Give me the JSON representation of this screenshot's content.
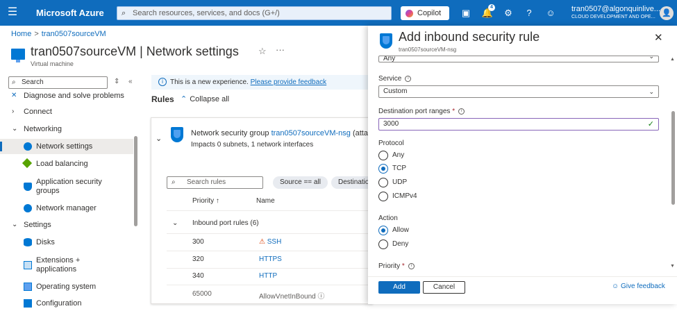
{
  "topbar": {
    "brand": "Microsoft Azure",
    "search_placeholder": "Search resources, services, and docs (G+/)",
    "copilot_label": "Copilot",
    "notification_count": "4",
    "user_email": "tran0507@algonquinlive...",
    "user_org": "CLOUD DEVELOPMENT AND OPE..."
  },
  "breadcrumb": {
    "home": "Home",
    "current": "tran0507sourceVM"
  },
  "page": {
    "title": "tran0507sourceVM | Network settings",
    "subtitle": "Virtual machine"
  },
  "sidebar": {
    "search_placeholder": "Search",
    "items": [
      {
        "label": "Diagnose and solve problems",
        "icon": "wrench-icon"
      },
      {
        "label": "Connect",
        "icon": "chevron-right-icon"
      },
      {
        "label": "Networking",
        "icon": "chevron-down-icon"
      },
      {
        "label": "Network settings",
        "icon": "network-settings-icon"
      },
      {
        "label": "Load balancing",
        "icon": "load-balancer-icon"
      },
      {
        "label": "Application security groups",
        "icon": "asg-icon"
      },
      {
        "label": "Network manager",
        "icon": "network-manager-icon"
      },
      {
        "label": "Settings",
        "icon": "chevron-down-icon"
      },
      {
        "label": "Disks",
        "icon": "disk-icon"
      },
      {
        "label": "Extensions + applications",
        "icon": "extensions-icon"
      },
      {
        "label": "Operating system",
        "icon": "monitor-icon"
      },
      {
        "label": "Configuration",
        "icon": "config-icon"
      }
    ]
  },
  "main": {
    "info_text": "This is a new experience.",
    "info_link": "Please provide feedback",
    "rules_label": "Rules",
    "collapse_label": "Collapse all",
    "nsg_prefix": "Network security group",
    "nsg_name": "tran0507sourceVM-nsg",
    "nsg_suffix": "(atta",
    "nsg_impacts": "Impacts 0 subnets, 1 network interfaces",
    "rules_search_placeholder": "Search rules",
    "filter_source": "Source == all",
    "filter_destination": "Destinatio",
    "col_priority": "Priority ↑",
    "col_name": "Name",
    "inbound_group": "Inbound port rules (6)",
    "rows": [
      {
        "priority": "300",
        "name": "SSH"
      },
      {
        "priority": "320",
        "name": "HTTPS"
      },
      {
        "priority": "340",
        "name": "HTTP"
      },
      {
        "priority": "65000",
        "name": "AllowVnetInBound"
      }
    ]
  },
  "panel": {
    "title": "Add inbound security rule",
    "subtitle": "tran0507sourceVM-nsg",
    "prev_value": "Any",
    "service_label": "Service",
    "service_value": "Custom",
    "dest_port_label": "Destination port ranges",
    "dest_port_value": "3000",
    "protocol_label": "Protocol",
    "protocol_options": [
      "Any",
      "TCP",
      "UDP",
      "ICMPv4"
    ],
    "protocol_selected": "TCP",
    "action_label": "Action",
    "action_options": [
      "Allow",
      "Deny"
    ],
    "action_selected": "Allow",
    "priority_label": "Priority",
    "add_label": "Add",
    "cancel_label": "Cancel",
    "feedback_label": "Give feedback"
  },
  "colors": {
    "accent": "#0f6cbd",
    "topbar": "#0f6cbd",
    "valid_check": "#107c10",
    "warning": "#d83b01"
  }
}
